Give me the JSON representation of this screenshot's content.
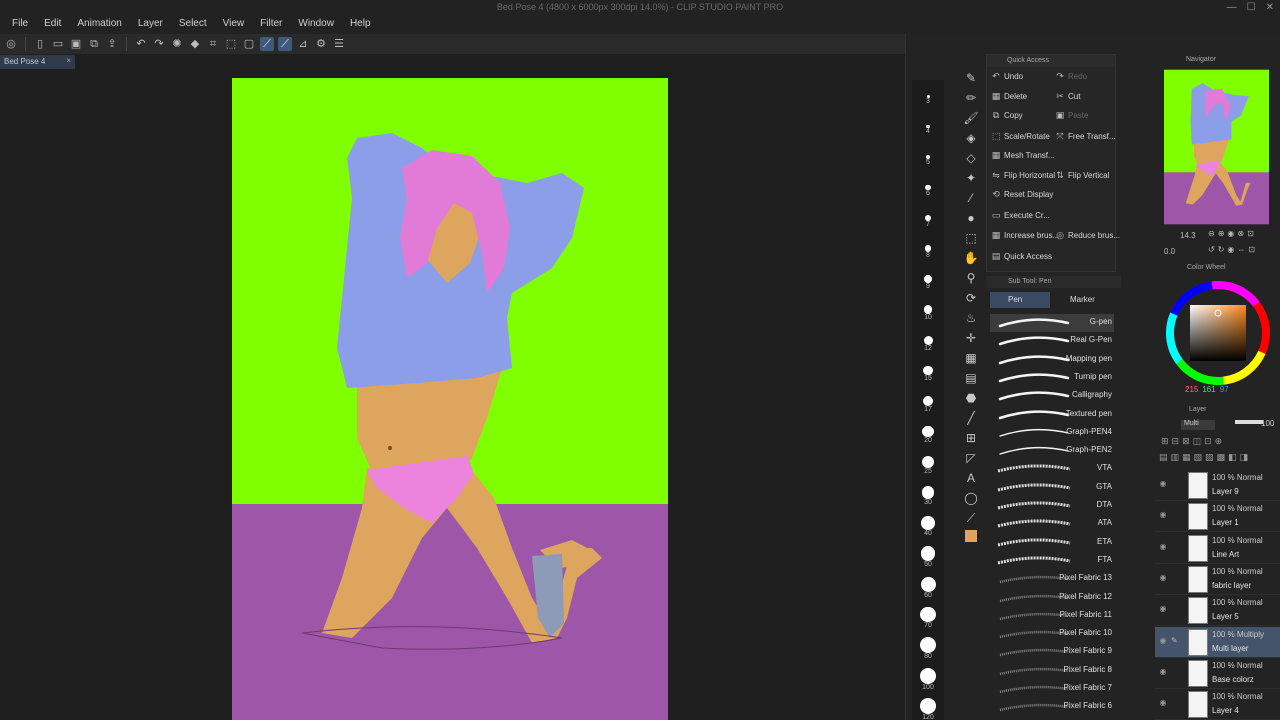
{
  "window": {
    "title": "Bed Pose 4 (4800 x 6000px 300dpi 14.0%) - CLIP STUDIO PAINT PRO",
    "controls": [
      "—",
      "☐",
      "✕"
    ]
  },
  "menu": [
    "File",
    "Edit",
    "Animation",
    "Layer",
    "Select",
    "View",
    "Filter",
    "Window",
    "Help"
  ],
  "document_tab": {
    "label": "Bed Pose 4",
    "close": "×"
  },
  "brush_sizes": [
    "3",
    "4",
    "5",
    "6",
    "7",
    "8",
    "9",
    "10",
    "12",
    "15",
    "17",
    "20",
    "25",
    "30",
    "40",
    "50",
    "60",
    "70",
    "80",
    "100",
    "120",
    "150"
  ],
  "quick_access": {
    "title": "Quick Access",
    "items": [
      {
        "label": "Undo",
        "enabled": true
      },
      {
        "label": "Redo",
        "enabled": false
      },
      {
        "label": "Delete",
        "enabled": true
      },
      {
        "label": "Cut",
        "enabled": true
      },
      {
        "label": "Copy",
        "enabled": true
      },
      {
        "label": "Paste",
        "enabled": false
      },
      {
        "label": "Scale/Rotate",
        "enabled": true
      },
      {
        "label": "Free Transf...",
        "enabled": true
      },
      {
        "label": "Mesh Transf...",
        "enabled": true
      },
      {
        "label": "Flip Horizontal",
        "enabled": true
      },
      {
        "label": "Flip Vertical",
        "enabled": true
      },
      {
        "label": "Reset Display",
        "enabled": true
      },
      {
        "label": "Execute Cr...",
        "enabled": true
      },
      {
        "label": "Increase brus...",
        "enabled": true
      },
      {
        "label": "Reduce brus...",
        "enabled": true
      },
      {
        "label": "Quick Access",
        "enabled": true
      }
    ]
  },
  "sub_tool": {
    "title": "Sub Tool: Pen",
    "tabs": [
      "Pen",
      "Marker"
    ],
    "brushes": [
      "G-pen",
      "Real G-Pen",
      "Mapping pen",
      "Turnip pen",
      "Calligraphy",
      "Textured pen",
      "Graph-PEN4",
      "Graph-PEN2",
      "VTA",
      "GTA",
      "DTA",
      "ATA",
      "ETA",
      "FTA",
      "Pixel Fabric 13",
      "Pixel Fabric 12",
      "Pixel Fabric 11",
      "Pixel Fabric 10",
      "Pixel Fabric 9",
      "Pixel Fabric 8",
      "Pixel Fabric 7",
      "Pixel Fabric 6"
    ],
    "selected": "G-pen"
  },
  "navigator": {
    "title": "Navigator",
    "zoom": "14.3",
    "angle": "0.0"
  },
  "color_wheel": {
    "title": "Color Wheel",
    "r": "215",
    "g": "161",
    "b": "97",
    "hue_color": "#d7a161"
  },
  "layer_panel": {
    "title": "Layer",
    "blend": "Multi",
    "opacity": "100",
    "layers": [
      {
        "mode": "100 % Normal",
        "name": "Layer 9",
        "selected": false
      },
      {
        "mode": "100 % Normal",
        "name": "Layer 1",
        "selected": false
      },
      {
        "mode": "100 % Normal",
        "name": "Line Art",
        "selected": false
      },
      {
        "mode": "100 % Normal",
        "name": "fabric layer",
        "selected": false
      },
      {
        "mode": "100 % Normal",
        "name": "Layer 5",
        "selected": false
      },
      {
        "mode": "100 % Multiply",
        "name": "Multi layer",
        "selected": true
      },
      {
        "mode": "100 % Normal",
        "name": "Base colorz",
        "selected": false
      },
      {
        "mode": "100 % Normal",
        "name": "Layer 4",
        "selected": false
      }
    ]
  },
  "colors": {
    "bg_green": "#7fff00",
    "bg_purple": "#9e57a8",
    "skin": "#dda55e",
    "shirt": "#8d9ee8",
    "hair": "#e27ad7",
    "underwear": "#ec83dc",
    "sock": "#8d9ab8"
  }
}
